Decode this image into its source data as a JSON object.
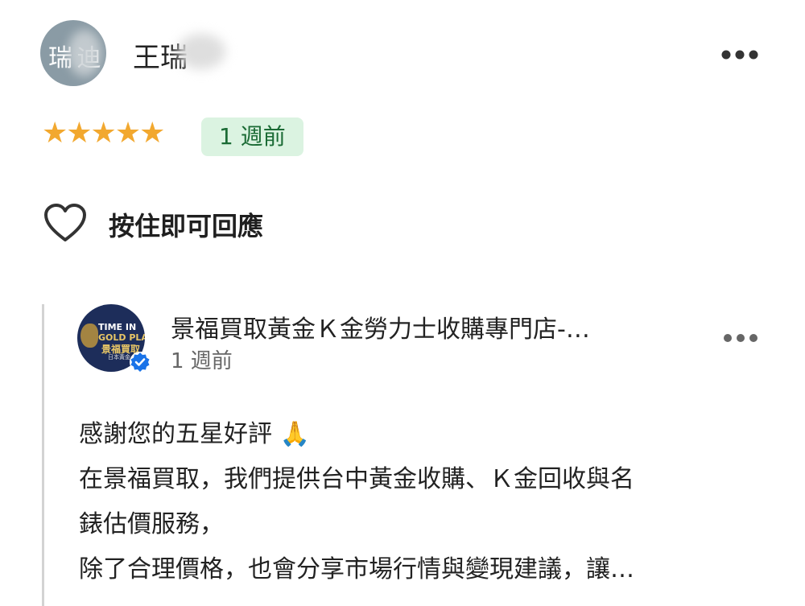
{
  "review": {
    "reviewer_initials": "瑞 迪",
    "reviewer_name": "王瑞",
    "stars": "★★★★★",
    "rating": 5,
    "time_ago": "1 週前",
    "more_icon": "more-horizontal-icon",
    "like_icon": "heart-outline-icon",
    "like_label": "按住即可回應"
  },
  "owner_reply": {
    "avatar_lines": [
      "TIME IN",
      "GOLD PLAZ",
      "景福買取",
      "日本黃金"
    ],
    "name": "景福買取黃金Ｋ金勞力士收購專門店-…",
    "time_ago": "1 週前",
    "more_icon": "more-horizontal-icon",
    "verified_icon": "verified-badge-icon",
    "lines": [
      "感謝您的五星好評 🙏",
      "在景福買取，我們提供台中黃金收購、Ｋ金回收與名",
      "錶估價服務，",
      "除了合理價格，也會分享市場行情與變現建議，讓…"
    ]
  },
  "colors": {
    "star": "#f2a82f",
    "badge_bg": "#dbf3e1",
    "badge_text": "#1b6b35",
    "verified": "#1a73e8",
    "avatar_bg": "#8a9ba5",
    "owner_avatar_bg": "#1d2d5a"
  }
}
